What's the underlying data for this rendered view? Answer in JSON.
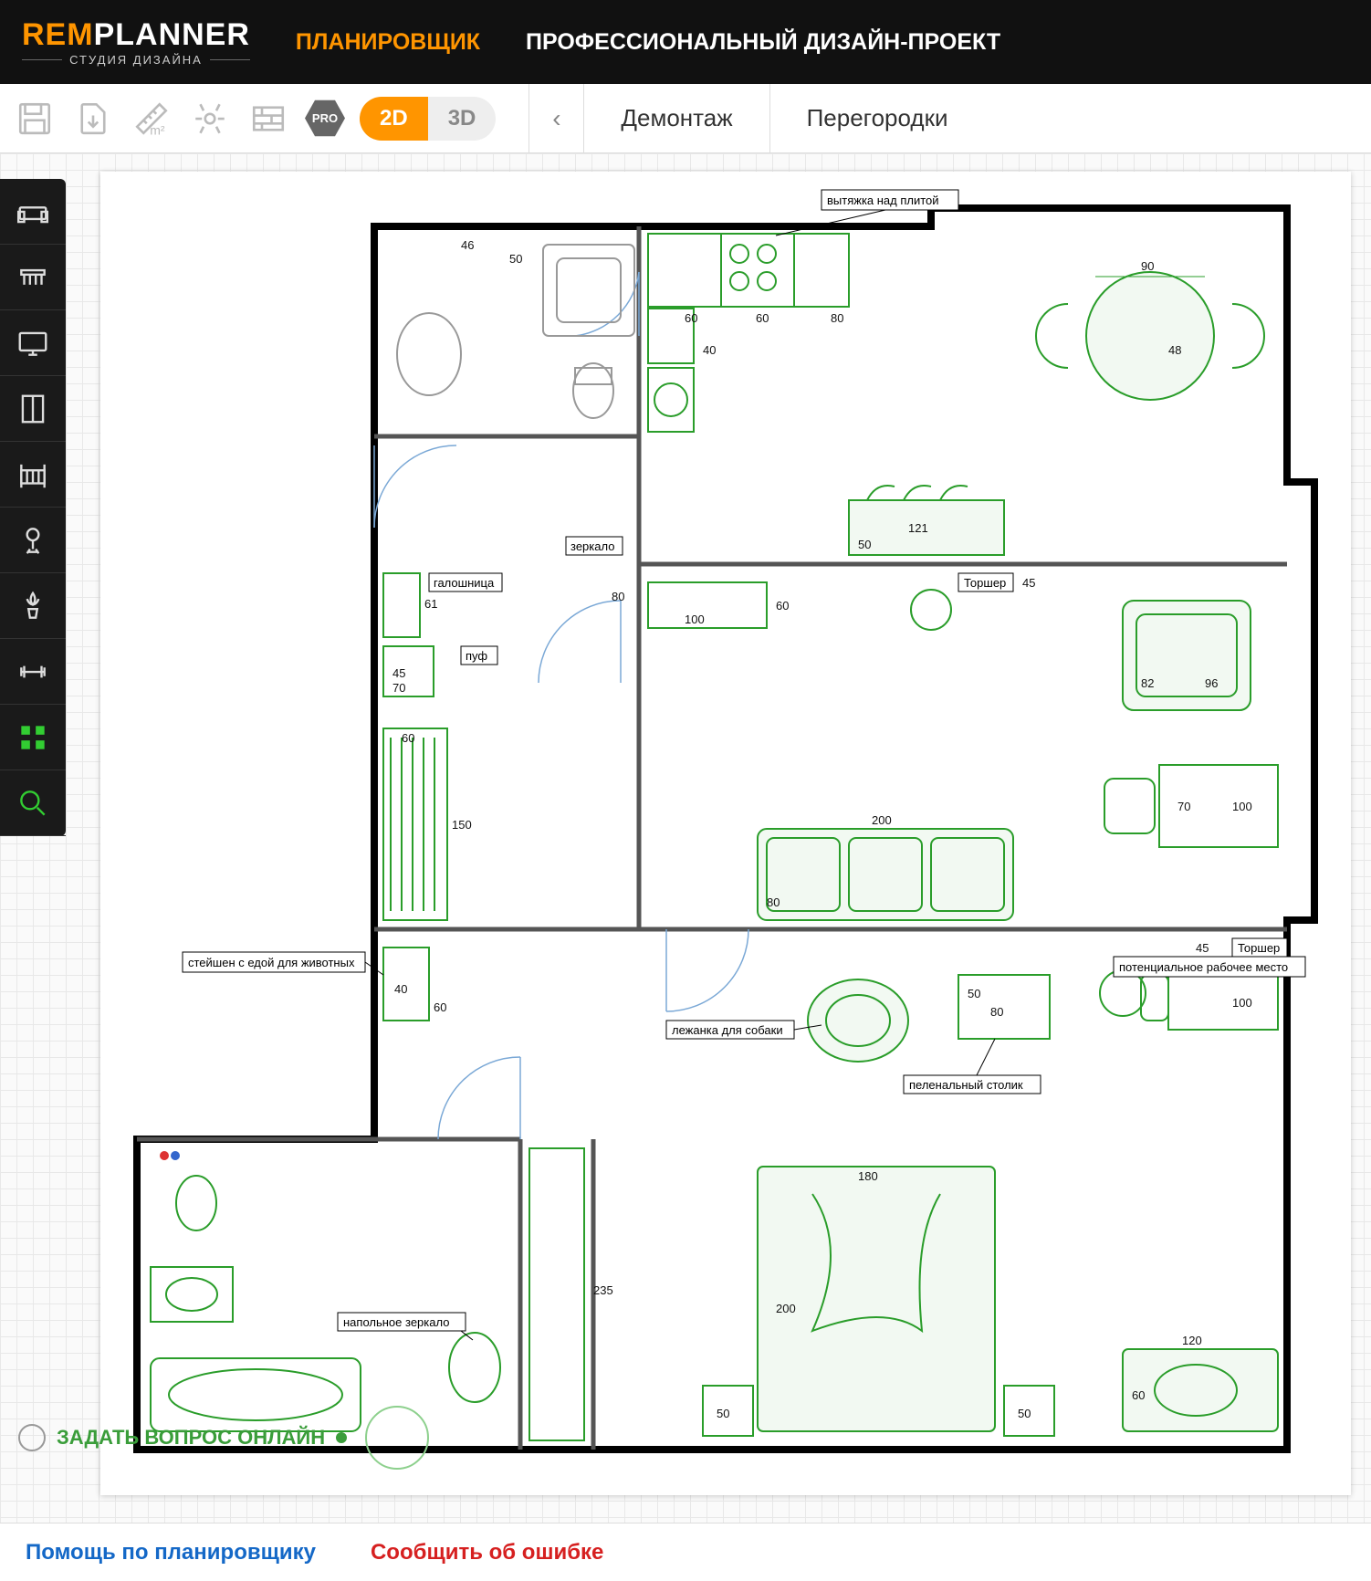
{
  "brand": {
    "rem": "REM",
    "planner": "PLANNER",
    "subtitle": "СТУДИЯ ДИЗАЙНА"
  },
  "nav": {
    "planner": "ПЛАНИРОВЩИК",
    "pro_design": "ПРОФЕССИОНАЛЬНЫЙ ДИЗАЙН-ПРОЕКТ"
  },
  "toolbar": {
    "pro": "PRO",
    "view_2d": "2D",
    "view_3d": "3D",
    "tab_demolition": "Демонтаж",
    "tab_partitions": "Перегородки"
  },
  "palette": [
    "sofa-icon",
    "table-icon",
    "tv-icon",
    "wardrobe-icon",
    "crib-icon",
    "chair-icon",
    "plant-icon",
    "gym-icon",
    "grid-icon",
    "search-icon"
  ],
  "plan": {
    "labels": {
      "hood": "вытяжка над плитой",
      "mirror": "зеркало",
      "shoe_rack": "галошница",
      "pouf": "пуф",
      "pet_station": "стейшен с едой для животных",
      "dog_bed": "лежанка для собаки",
      "changing_table": "пеленальный столик",
      "workplace": "потенциальное рабочее место",
      "floor_lamp": "Торшер",
      "floor_lamp2": "Торшер",
      "floor_mirror": "напольное зеркало"
    },
    "dimensions": {
      "d46": "46",
      "d50": "50",
      "d60": "60",
      "d61": "61",
      "d45": "45",
      "d70": "70",
      "d80": "80",
      "d90": "90",
      "d48": "48",
      "d40": "40",
      "d121": "121",
      "d150": "150",
      "d100": "100",
      "d200": "200",
      "d235": "235",
      "d120": "120",
      "d82": "82",
      "d96": "96",
      "d180": "180"
    }
  },
  "chat": {
    "label": "ЗАДАТЬ ВОПРОС ОНЛАЙН"
  },
  "footer": {
    "help": "Помощь по планировщику",
    "error": "Сообщить об ошибке"
  }
}
